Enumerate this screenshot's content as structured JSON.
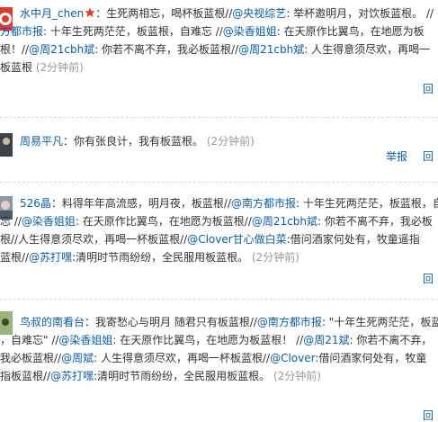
{
  "posts": [
    {
      "username": "水中月_chen",
      "lines": [
        [
          {
            "t": "text",
            "v": "：生死两相忘，喝杯板蓝根//"
          },
          {
            "t": "mention",
            "v": "@央视综艺"
          },
          {
            "t": "text",
            "v": ": 举杯邀明月，对饮板蓝根。 //"
          }
        ],
        [
          {
            "t": "mention",
            "v": "方都市报"
          },
          {
            "t": "text",
            "v": ": 十年生死两茫茫，板蓝根，自难忘 //"
          },
          {
            "t": "mention",
            "v": "@染香姐姐"
          },
          {
            "t": "text",
            "v": ": 在天原作比翼鸟，在地愿为板"
          }
        ],
        [
          {
            "t": "text",
            "v": "根！//"
          },
          {
            "t": "mention",
            "v": "@周21cbh斌"
          },
          {
            "t": "text",
            "v": ": 你若不离不弃，我必板蓝根//"
          },
          {
            "t": "mention",
            "v": "@周21cbh斌"
          },
          {
            "t": "text",
            "v": ": 人生得意须尽欢，再喝一"
          }
        ],
        [
          {
            "t": "text",
            "v": "板蓝根"
          }
        ]
      ],
      "time": "(2分钟前)",
      "actions": [
        "回"
      ]
    },
    {
      "username": "周易平凡",
      "lines": [
        [
          {
            "t": "text",
            "v": "：你有张良计，我有板蓝根。"
          }
        ]
      ],
      "time": "(2分钟前)",
      "actions": [
        "举报",
        "回"
      ]
    },
    {
      "username": "526晶",
      "lines": [
        [
          {
            "t": "text",
            "v": "：料得年年高流感，明月夜，板蓝根//"
          },
          {
            "t": "mention",
            "v": "@南方都市报"
          },
          {
            "t": "text",
            "v": ": 十年生死两茫茫，板蓝根，自"
          }
        ],
        [
          {
            "t": "text",
            "v": "忘 //"
          },
          {
            "t": "mention",
            "v": "@染香姐姐"
          },
          {
            "t": "text",
            "v": ": 在天原作比翼鸟，在地愿为板蓝根//"
          },
          {
            "t": "mention",
            "v": "@周21cbh斌"
          },
          {
            "t": "text",
            "v": ": 你若不离不弃，我必板"
          }
        ],
        [
          {
            "t": "text",
            "v": "根//人生得意须尽欢，再喝一杯板蓝根//"
          },
          {
            "t": "mention",
            "v": "@Clover甘心做白菜"
          },
          {
            "t": "text",
            "v": ":借问酒家何处有，牧童遥指"
          }
        ],
        [
          {
            "t": "text",
            "v": "蓝根//"
          },
          {
            "t": "mention",
            "v": "@苏打嘿"
          },
          {
            "t": "text",
            "v": ":清明时节雨纷纷，全民服用板蓝根。"
          }
        ]
      ],
      "time": "(2分钟前)",
      "actions": [
        "回"
      ]
    },
    {
      "username": "鸟叔的南看台",
      "lines": [
        [
          {
            "t": "text",
            "v": "：我寄愁心与明月 随君只有板蓝根//"
          },
          {
            "t": "mention",
            "v": "@南方都市报"
          },
          {
            "t": "text",
            "v": ": \"十年生死两茫茫，板蓝"
          }
        ],
        [
          {
            "t": "text",
            "v": "，自难忘\" //"
          },
          {
            "t": "mention",
            "v": "@染香姐姐"
          },
          {
            "t": "text",
            "v": ": 在天原作比翼鸟，在地愿为板蓝根！ //"
          },
          {
            "t": "mention",
            "v": "@周21斌"
          },
          {
            "t": "text",
            "v": ": 你若不离不弃，"
          }
        ],
        [
          {
            "t": "text",
            "v": "我必板蓝根//"
          },
          {
            "t": "mention",
            "v": "@周斌"
          },
          {
            "t": "text",
            "v": ": 人生得意须尽欢，再喝一杯板蓝根//"
          },
          {
            "t": "mention",
            "v": "@Clover"
          },
          {
            "t": "text",
            "v": ":借问酒家何处有，牧童"
          }
        ],
        [
          {
            "t": "text",
            "v": "指板蓝根//"
          },
          {
            "t": "mention",
            "v": "@苏打嘿"
          },
          {
            "t": "text",
            "v": ":清明时节雨纷纷，全民服用板蓝根。"
          }
        ]
      ],
      "time": "(2分钟前)",
      "actions": [
        "回"
      ]
    }
  ],
  "colors": {
    "link": "#0a5ea8",
    "text": "#333333",
    "time": "#999999",
    "divider": "#d9d9d9",
    "vip_badge": "#e8361d"
  },
  "icons": {
    "vip_badge": "vip-star-icon"
  }
}
